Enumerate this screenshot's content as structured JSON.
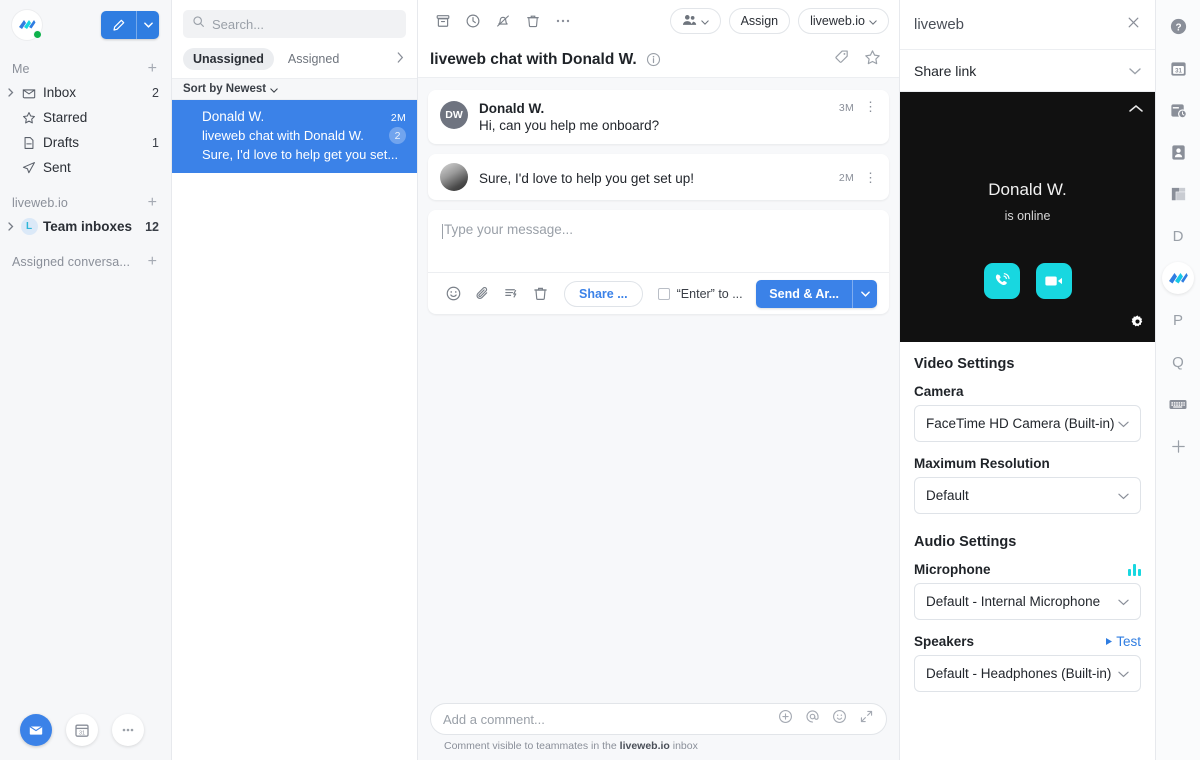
{
  "sidebar": {
    "logo_icon": "front-logo-icon",
    "status_dot": "online-status-dot",
    "compose_button": {
      "icon": "pencil-icon",
      "caret_icon": "chevron-down-icon"
    },
    "sections": [
      {
        "title": "Me",
        "add_icon": "plus-icon",
        "items": [
          {
            "label": "Inbox",
            "count": "2",
            "icon": "inbox-icon",
            "chevron": true,
            "bold": false
          },
          {
            "label": "Starred",
            "count": "",
            "icon": "star-icon",
            "chevron": false,
            "bold": false
          },
          {
            "label": "Drafts",
            "count": "1",
            "icon": "draft-icon",
            "chevron": false,
            "bold": false
          },
          {
            "label": "Sent",
            "count": "",
            "icon": "send-icon",
            "chevron": false,
            "bold": false
          }
        ]
      },
      {
        "title": "liveweb.io",
        "add_icon": "plus-icon",
        "items": [
          {
            "label": "Team inboxes",
            "count": "12",
            "icon": "team-avatar-L",
            "chevron": true,
            "bold": true
          }
        ]
      },
      {
        "title": "Assigned conversa...",
        "add_icon": "plus-icon",
        "items": []
      }
    ],
    "bottom_buttons": [
      {
        "name": "inbox-fab",
        "icon": "inbox-icon",
        "style": "blue"
      },
      {
        "name": "calendar-fab",
        "icon": "calendar-icon",
        "style": "white"
      },
      {
        "name": "more-fab",
        "icon": "ellipsis-icon",
        "style": "white"
      }
    ]
  },
  "conversation_list": {
    "search": {
      "placeholder": "Search...",
      "value": "",
      "icon": "search-icon"
    },
    "filters": [
      {
        "label": "Unassigned",
        "active": true
      },
      {
        "label": "Assigned",
        "active": false
      }
    ],
    "filter_more_icon": "chevron-right-icon",
    "sort": {
      "label": "Sort by Newest",
      "icon": "chevron-down-icon"
    },
    "items": [
      {
        "name": "Donald W.",
        "time": "2M",
        "subject": "liveweb chat with Donald W.",
        "preview": "Sure, I'd love to help get you set...",
        "badge": "2",
        "selected": true
      }
    ]
  },
  "main": {
    "toolbar_icons": [
      {
        "name": "archive-icon"
      },
      {
        "name": "snooze-clock-icon"
      },
      {
        "name": "mute-bell-icon"
      },
      {
        "name": "trash-icon"
      },
      {
        "name": "more-horizontal-icon"
      }
    ],
    "assignee_button": {
      "icon": "people-icon",
      "caret_icon": "chevron-down-icon"
    },
    "assign_button": {
      "label": "Assign"
    },
    "inbox_button": {
      "label": "liveweb.io",
      "caret_icon": "chevron-down-icon"
    },
    "title": "liveweb chat with Donald W.",
    "info_icon": "info-circle-icon",
    "tag_icon": "tag-icon",
    "star_icon": "star-icon",
    "messages": [
      {
        "avatar_initials": "DW",
        "avatar_type": "initials",
        "name": "Donald W.",
        "text": "Hi, can you help me onboard?",
        "time": "3M",
        "menu_icon": "kebab-menu-icon"
      },
      {
        "avatar_initials": "",
        "avatar_type": "photo",
        "name": "",
        "text": "Sure, I'd love to help you get set up!",
        "time": "2M",
        "menu_icon": "kebab-menu-icon"
      }
    ],
    "composer": {
      "placeholder": "Type your message...",
      "value": "",
      "icons": [
        {
          "name": "emoji-icon"
        },
        {
          "name": "attachment-icon"
        },
        {
          "name": "canned-response-icon"
        },
        {
          "name": "trash-icon"
        }
      ],
      "share_button": "Share ...",
      "enter_checkbox": {
        "label": "“Enter” to ...",
        "checked": false
      },
      "send_button": {
        "label": "Send & Ar...",
        "caret_icon": "chevron-down-icon"
      }
    },
    "comment": {
      "placeholder": "Add a comment...",
      "value": "",
      "icons": [
        {
          "name": "add-circle-icon"
        },
        {
          "name": "mention-icon"
        },
        {
          "name": "emoji-icon"
        },
        {
          "name": "expand-icon"
        }
      ],
      "note_prefix": "Comment visible to teammates in the ",
      "note_bold": "liveweb.io",
      "note_suffix": " inbox"
    }
  },
  "right_panel": {
    "title": "liveweb",
    "close_icon": "close-icon",
    "share_link": {
      "label": "Share link",
      "caret_icon": "chevron-down-icon"
    },
    "video": {
      "collapse_icon": "chevron-up-icon",
      "name": "Donald W.",
      "status": "is online",
      "call_button_icon": "phone-ring-icon",
      "video_button_icon": "video-camera-icon",
      "gear_icon": "gear-icon",
      "accent_color": "#18d7e0",
      "background_color": "#111111"
    },
    "settings": {
      "video_heading": "Video Settings",
      "camera_label": "Camera",
      "camera_value": "FaceTime HD Camera (Built-in)",
      "resolution_label": "Maximum Resolution",
      "resolution_value": "Default",
      "audio_heading": "Audio Settings",
      "microphone_label": "Microphone",
      "microphone_value": "Default - Internal Microphone",
      "mic_level_icon": "mic-level-icon",
      "speakers_label": "Speakers",
      "speakers_value": "Default - Headphones (Built-in)",
      "test_link": "Test",
      "test_icon": "play-icon"
    }
  },
  "rail": {
    "items": [
      {
        "name": "help-icon",
        "glyph": "?",
        "kind": "icon",
        "active": false
      },
      {
        "name": "calendar-icon",
        "glyph": "31",
        "kind": "icon",
        "active": false
      },
      {
        "name": "schedule-icon",
        "glyph": "",
        "kind": "icon",
        "active": false
      },
      {
        "name": "contact-icon",
        "glyph": "",
        "kind": "icon",
        "active": false
      },
      {
        "name": "kanban-icon",
        "glyph": "",
        "kind": "icon",
        "active": false
      },
      {
        "name": "app-d-icon",
        "glyph": "D",
        "kind": "letter",
        "active": false
      },
      {
        "name": "front-app-icon",
        "glyph": "",
        "kind": "icon",
        "active": true
      },
      {
        "name": "app-p-icon",
        "glyph": "P",
        "kind": "letter",
        "active": false
      },
      {
        "name": "app-q-icon",
        "glyph": "Q",
        "kind": "letter",
        "active": false
      },
      {
        "name": "keyboard-icon",
        "glyph": "",
        "kind": "icon",
        "active": false
      },
      {
        "name": "add-app-icon",
        "glyph": "+",
        "kind": "plus",
        "active": false
      }
    ]
  },
  "colors": {
    "brand_blue": "#3b82e8",
    "accent_cyan": "#18d7e0",
    "sidebar_bg": "#f6f7f9",
    "main_bg": "#f7f8fa",
    "video_bg": "#111111",
    "link_blue": "#2f7de1"
  }
}
